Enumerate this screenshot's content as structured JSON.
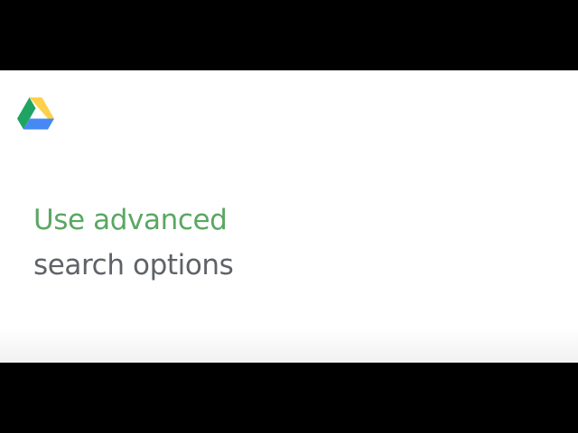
{
  "logo_icon": "google-drive-icon",
  "colors": {
    "background": "#ffffff",
    "letterbox": "#000000",
    "headline_accent": "#5aa762",
    "headline_secondary": "#5f6368",
    "drive_green": "#1fa463",
    "drive_yellow": "#ffd04b",
    "drive_blue": "#4688f4"
  },
  "headline": {
    "line1": "Use advanced",
    "line2": "search options"
  }
}
